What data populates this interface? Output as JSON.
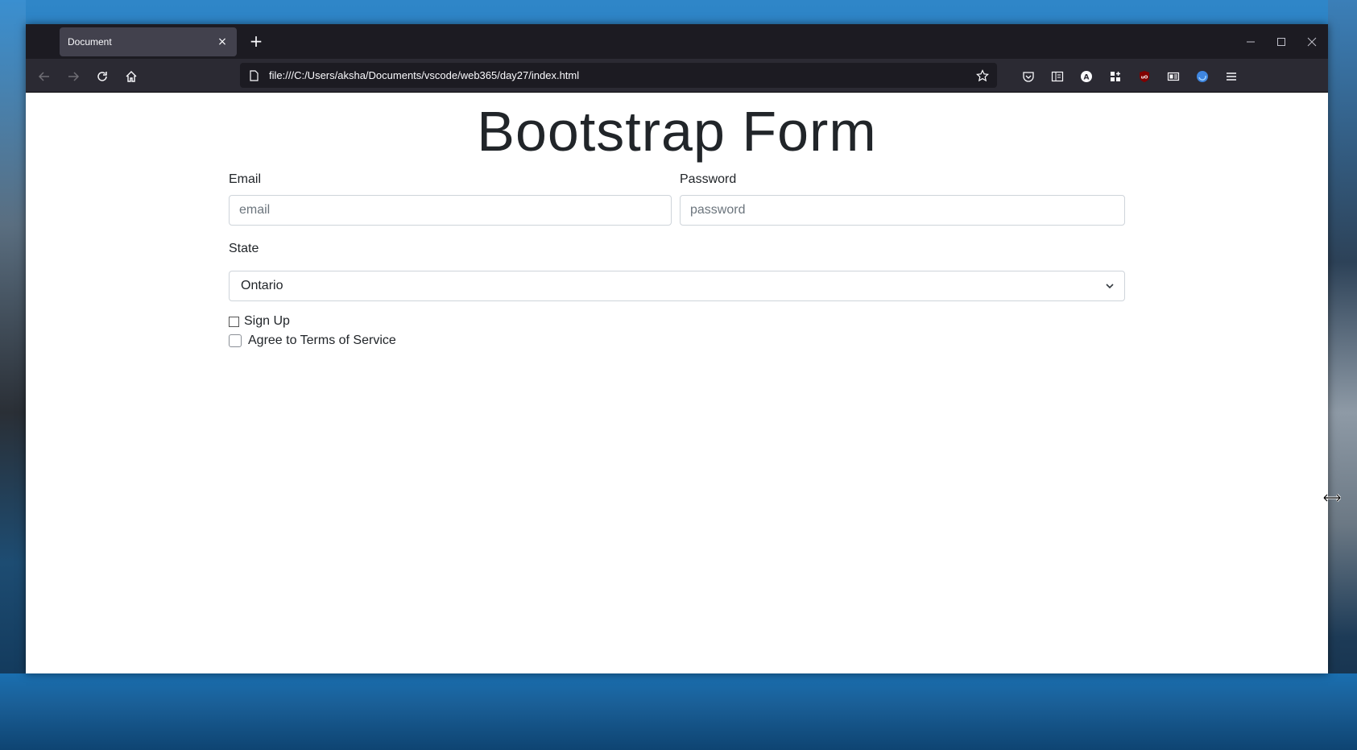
{
  "browser": {
    "tab_title": "Document",
    "tab_close": "×",
    "new_tab": "+",
    "url": "file:///C:/Users/aksha/Documents/vscode/web365/day27/index.html",
    "window_controls": {
      "minimize": "─",
      "maximize": "☐",
      "close": "✕"
    }
  },
  "page": {
    "title": "Bootstrap Form",
    "email": {
      "label": "Email",
      "placeholder": "email",
      "value": ""
    },
    "password": {
      "label": "Password",
      "placeholder": "password",
      "value": ""
    },
    "state": {
      "label": "State",
      "selected": "Ontario"
    },
    "checkboxes": {
      "signup": {
        "label": "Sign Up",
        "checked": false
      },
      "terms": {
        "label": "Agree to Terms of Service",
        "checked": false
      }
    }
  },
  "icons": [
    "back-arrow-icon",
    "forward-arrow-icon",
    "reload-icon",
    "home-icon",
    "page-icon",
    "bookmark-star-icon",
    "pocket-icon",
    "reader-view-icon",
    "account-icon",
    "extensions-icon",
    "ublock-icon",
    "reader-icon",
    "firefox-relay-icon",
    "menu-icon",
    "chevron-down-icon",
    "resize-cursor-icon"
  ],
  "colors": {
    "tabbar_bg": "#1c1b22",
    "navbar_bg": "#2b2a33",
    "tab_active_bg": "#42414d",
    "text_dark": "#212529",
    "input_border": "#ced4da"
  }
}
